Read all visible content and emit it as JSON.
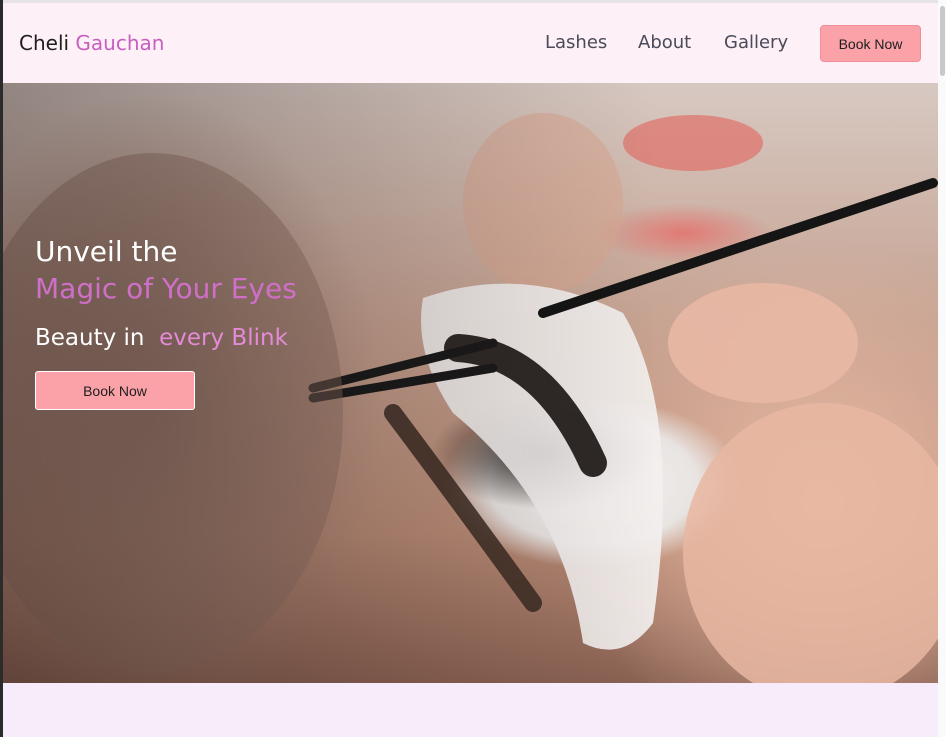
{
  "navbar": {
    "brand_first": "Cheli",
    "brand_second": "Gauchan",
    "links": [
      "Lashes",
      "About",
      "Gallery"
    ],
    "cta_label": "Book Now"
  },
  "hero": {
    "line1": "Unveil the",
    "line2": "Magic of Your Eyes",
    "line3_prefix": "Beauty in  ",
    "line3_accent": "every Blink",
    "cta_label": "Book Now",
    "image_subject": "eyelash extension application photo"
  },
  "colors": {
    "brand_accent": "#c85fc0",
    "button": "#fba1a8",
    "page_bg": "#faeef8"
  }
}
